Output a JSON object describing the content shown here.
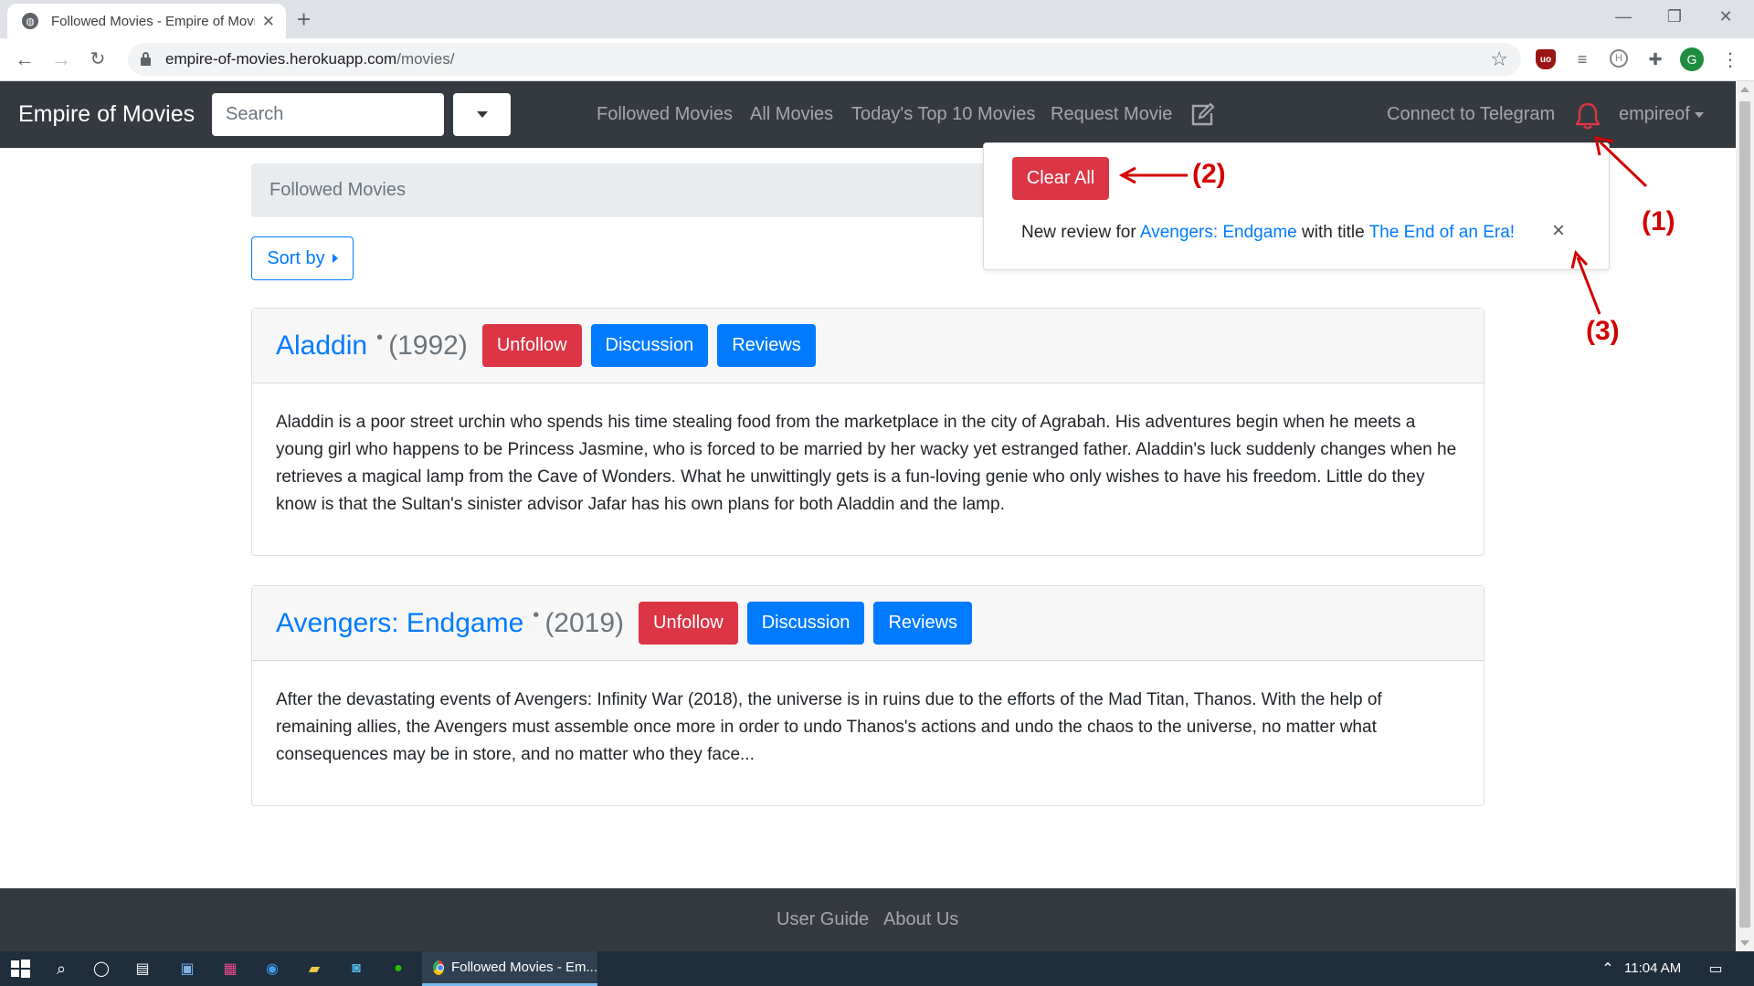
{
  "browser": {
    "tab_title": "Followed Movies - Empire of Movies",
    "favicon": "globe-icon",
    "url_host": "empire-of-movies.herokuapp.com",
    "url_path": "/movies/",
    "profile_initial": "G"
  },
  "navbar": {
    "brand": "Empire of Movies",
    "search_placeholder": "Search",
    "links": {
      "followed": "Followed Movies",
      "all": "All Movies",
      "top10": "Today's Top 10 Movies",
      "request": "Request Movie",
      "telegram": "Connect to Telegram"
    },
    "user": "empireof",
    "bell_color": "#dc3545"
  },
  "breadcrumb": "Followed Movies",
  "sort_label": "Sort by",
  "movies": [
    {
      "title": "Aladdin",
      "year": "(1992)",
      "unfollow": "Unfollow",
      "discussion": "Discussion",
      "reviews": "Reviews",
      "description": "Aladdin is a poor street urchin who spends his time stealing food from the marketplace in the city of Agrabah. His adventures begin when he meets a young girl who happens to be Princess Jasmine, who is forced to be married by her wacky yet estranged father. Aladdin's luck suddenly changes when he retrieves a magical lamp from the Cave of Wonders. What he unwittingly gets is a fun-loving genie who only wishes to have his freedom. Little do they know is that the Sultan's sinister advisor Jafar has his own plans for both Aladdin and the lamp."
    },
    {
      "title": "Avengers: Endgame",
      "year": "(2019)",
      "unfollow": "Unfollow",
      "discussion": "Discussion",
      "reviews": "Reviews",
      "description": "After the devastating events of Avengers: Infinity War (2018), the universe is in ruins due to the efforts of the Mad Titan, Thanos. With the help of remaining allies, the Avengers must assemble once more in order to undo Thanos's actions and undo the chaos to the universe, no matter what consequences may be in store, and no matter who they face..."
    }
  ],
  "notifications": {
    "clear_all": "Clear All",
    "item": {
      "prefix": "New review for",
      "movie": "Avengers: Endgame",
      "middle": "with title",
      "review_title": "The End of an Era!",
      "close": "×"
    }
  },
  "annotations": {
    "one": "(1)",
    "two": "(2)",
    "three": "(3)",
    "color": "#d40000"
  },
  "footer": {
    "user_guide": "User Guide",
    "about_us": "About Us"
  },
  "taskbar": {
    "app_label": "Followed Movies - Em...",
    "time": "11:04 AM"
  }
}
